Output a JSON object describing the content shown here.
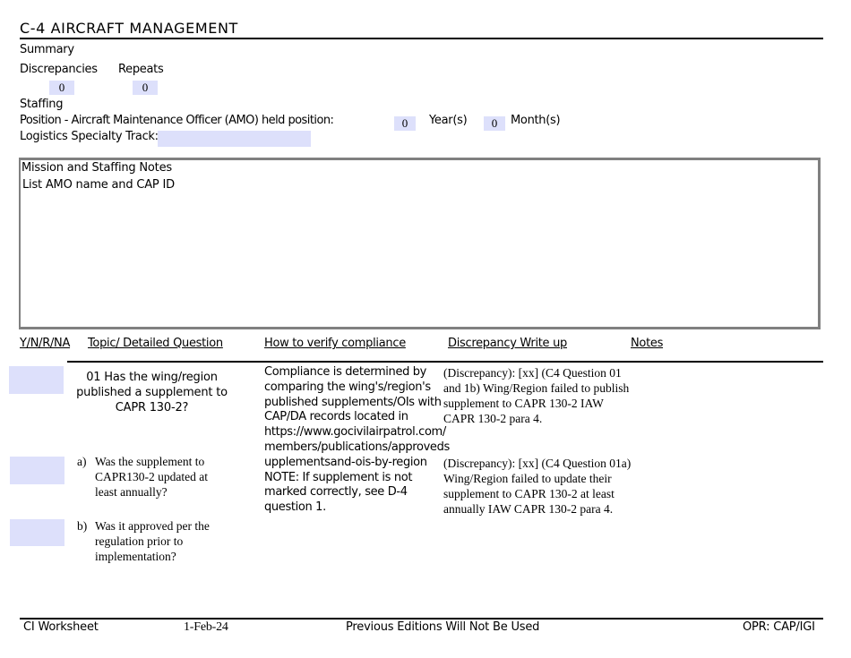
{
  "title": "C-4 AIRCRAFT MANAGEMENT",
  "summary": {
    "heading": "Summary",
    "discrepancies_label": "Discrepancies",
    "discrepancies_value": "0",
    "repeats_label": "Repeats",
    "repeats_value": "0"
  },
  "staffing": {
    "heading": "Staffing",
    "position_label": "Position - Aircraft Maintenance Officer (AMO) held position:",
    "years_value": "0",
    "years_label": "Year(s)",
    "months_value": "0",
    "months_label": "Month(s)",
    "logistics_label": "Logistics Specialty Track:",
    "logistics_value": ""
  },
  "notes_box": {
    "label": "Mission and Staffing Notes",
    "value": "List AMO name and CAP ID"
  },
  "columns": {
    "ynrna": "Y/N/R/NA",
    "topic": "Topic/ Detailed Question",
    "verify": "How to verify compliance",
    "discrepancy": "Discrepancy Write up",
    "notes": "Notes"
  },
  "questions": [
    {
      "number": "01",
      "text": "01  Has the wing/region published a supplement to CAPR 130-2?",
      "answer": "",
      "verify": "Compliance is determined by comparing the wing's/region's published supplements/OIs with CAP/DA records located in https://www.gocivilairpatrol.com/ members/publications/approveds upplementsand-ois-by-region NOTE: If supplement is not marked correctly, see D-4 question 1.",
      "discrepancy": "(Discrepancy): [xx] (C4 Question 01 and 1b) Wing/Region failed to publish supplement to CAPR 130-2 IAW CAPR 130-2 para 4."
    },
    {
      "mark": "a)",
      "text": "Was the supplement to CAPR130-2 updated at least annually?",
      "answer": "",
      "discrepancy": "(Discrepancy): [xx] (C4 Question 01a) Wing/Region failed to update their supplement to CAPR 130-2 at least annually IAW CAPR 130-2 para 4."
    },
    {
      "mark": "b)",
      "text": "Was it approved per the regulation prior to implementation?",
      "answer": ""
    }
  ],
  "footer": {
    "left": "CI Worksheet",
    "date": "1-Feb-24",
    "center": "Previous Editions Will Not Be Used",
    "right": "OPR: CAP/IGI"
  }
}
